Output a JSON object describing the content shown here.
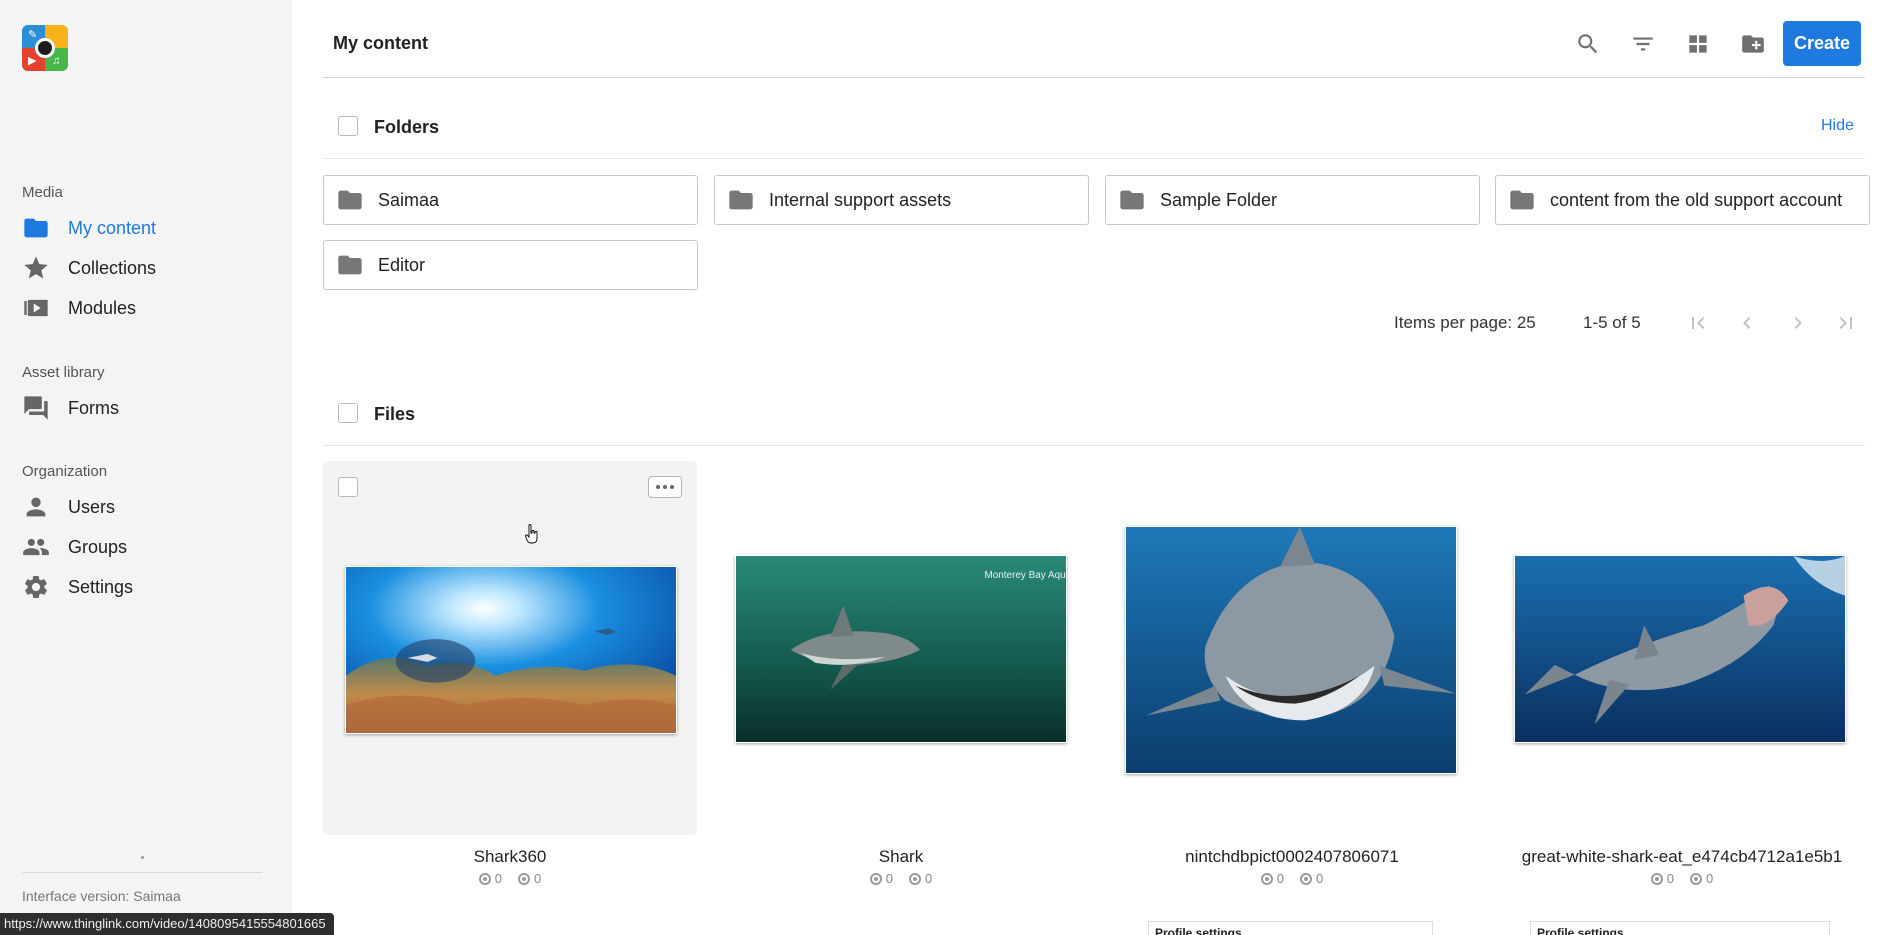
{
  "colors": {
    "accent": "#1f7ae0",
    "sidebar_bg": "#f4f4f4"
  },
  "sidebar": {
    "sections": [
      {
        "label": "Media",
        "items": [
          {
            "label": "My content",
            "icon": "folder-icon",
            "active": true
          },
          {
            "label": "Collections",
            "icon": "star-icon"
          },
          {
            "label": "Modules",
            "icon": "video-icon"
          }
        ]
      },
      {
        "label": "Asset library",
        "items": [
          {
            "label": "Forms",
            "icon": "forum-icon"
          }
        ]
      },
      {
        "label": "Organization",
        "items": [
          {
            "label": "Users",
            "icon": "person-icon"
          },
          {
            "label": "Groups",
            "icon": "people-icon"
          },
          {
            "label": "Settings",
            "icon": "gear-icon"
          }
        ]
      }
    ],
    "version": "Interface version: Saimaa"
  },
  "header": {
    "title": "My content",
    "toolbar": [
      "search-icon",
      "filter-icon",
      "grid-view-icon",
      "new-folder-icon"
    ],
    "create_label": "Create"
  },
  "folders": {
    "title": "Folders",
    "hide_label": "Hide",
    "items": [
      "Saimaa",
      "Internal support assets",
      "Sample Folder",
      "content from the old support account",
      "Editor"
    ]
  },
  "pagination": {
    "items_per_page": "Items per page: 25",
    "range": "1-5 of 5"
  },
  "files": {
    "title": "Files",
    "items": [
      {
        "name": "Shark360",
        "views": "0",
        "interactions": "0"
      },
      {
        "name": "Shark",
        "views": "0",
        "interactions": "0",
        "watermark": "Monterey Bay Aquarium"
      },
      {
        "name": "nintchdbpict0002407806071",
        "views": "0",
        "interactions": "0"
      },
      {
        "name": "great-white-shark-eat_e474cb4712a1e5b1",
        "views": "0",
        "interactions": "0"
      }
    ],
    "next_row_peek": [
      "Profile settings",
      "Profile settings"
    ]
  },
  "status_bar_url": "https://www.thinglink.com/video/1408095415554801665"
}
